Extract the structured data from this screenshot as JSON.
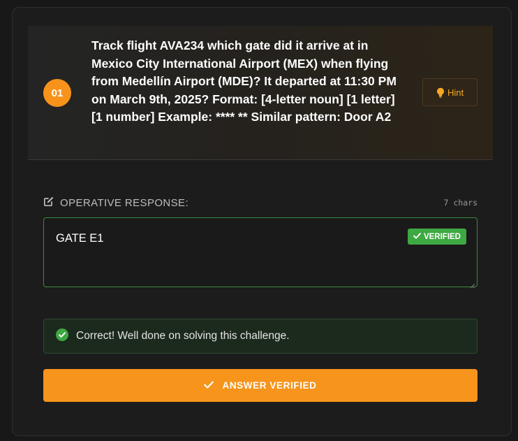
{
  "question": {
    "number": "01",
    "text": "Track flight AVA234 which gate did it arrive at in Mexico City International Airport (MEX) when flying from Medellín Airport (MDE)? It departed at 11:30 PM on March 9th, 2025? Format: [4-letter noun] [1 letter][1 number] Example: **** ** Similar pattern: Door A2",
    "hint_label": "Hint",
    "hint_icon": "lightbulb-icon"
  },
  "response": {
    "label": "OPERATIVE RESPONSE:",
    "label_icon": "edit-icon",
    "char_count": "7 chars",
    "value": "GATE E1",
    "verified_label": "VERIFIED",
    "verified_icon": "check-icon"
  },
  "feedback": {
    "message": "Correct! Well done on solving this challenge.",
    "icon": "check-circle-icon"
  },
  "submit": {
    "label": "ANSWER VERIFIED",
    "icon": "check-icon"
  },
  "colors": {
    "accent": "#f7931a",
    "success": "#3ea842",
    "background": "#181818"
  }
}
